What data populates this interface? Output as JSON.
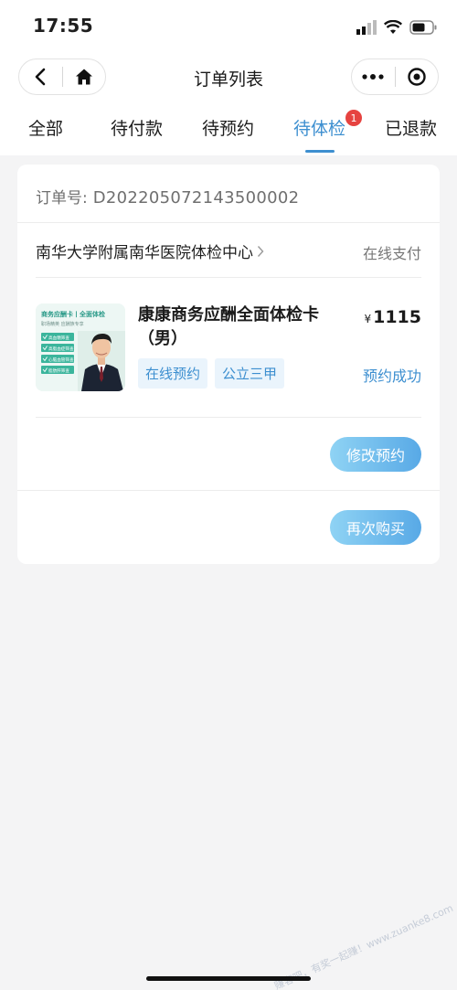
{
  "status_bar": {
    "time": "17:55"
  },
  "nav": {
    "title": "订单列表"
  },
  "tabs": [
    {
      "label": "全部",
      "active": false
    },
    {
      "label": "待付款",
      "active": false
    },
    {
      "label": "待预约",
      "active": false
    },
    {
      "label": "待体检",
      "active": true,
      "badge": "1"
    },
    {
      "label": "已退款",
      "active": false
    }
  ],
  "order": {
    "number_label": "订单号:",
    "number": "D202205072143500002",
    "hospital": "南华大学附属南华医院体检中心",
    "payment_method": "在线支付",
    "product": {
      "image_title": "商务应酬卡丨全面体检",
      "image_subtitle": "职场精英 应酬族专享",
      "image_items": [
        "高血糖筛查",
        "高脂血症筛查",
        "心脑血管筛查",
        "脂肪肝筛查"
      ],
      "title": "康康商务应酬全面体检卡（男）",
      "currency": "¥",
      "price": "1115",
      "tags": [
        "在线预约",
        "公立三甲"
      ],
      "status": "预约成功"
    },
    "buttons": {
      "modify": "修改预约",
      "rebuy": "再次购买"
    }
  },
  "watermark": "赚客吧，有奖一起赚！www.zuanke8.com",
  "colors": {
    "accent": "#3d8fd0",
    "badge": "#e64340",
    "button_start": "#8fd3f4",
    "button_end": "#58a9e6"
  }
}
